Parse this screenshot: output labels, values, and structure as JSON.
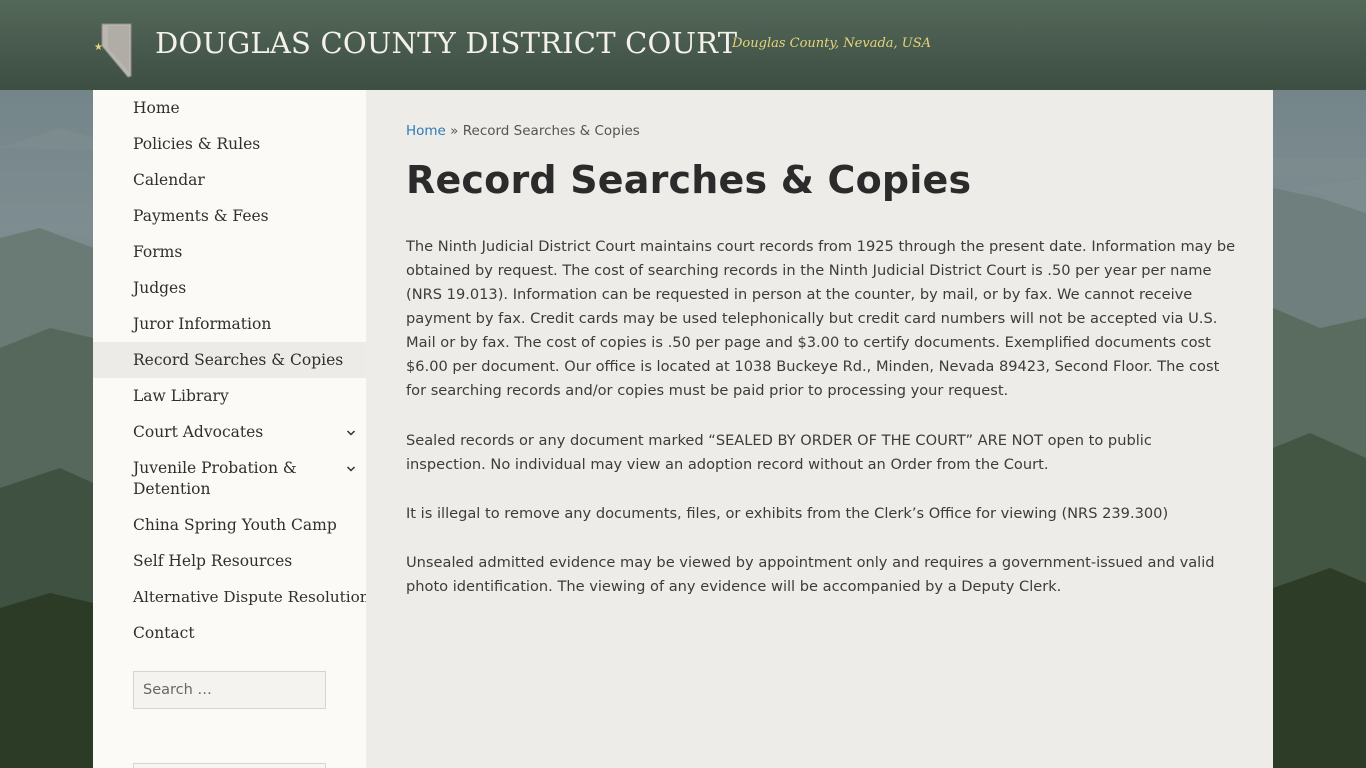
{
  "header": {
    "site_title": "DOUGLAS COUNTY DISTRICT COURT",
    "tagline": "Douglas County, Nevada, USA",
    "logo_icon": "nevada-state-icon"
  },
  "sidebar": {
    "items": [
      {
        "label": "Home"
      },
      {
        "label": "Policies & Rules"
      },
      {
        "label": "Calendar"
      },
      {
        "label": "Payments & Fees"
      },
      {
        "label": "Forms"
      },
      {
        "label": "Judges"
      },
      {
        "label": "Juror Information"
      },
      {
        "label": "Record Searches & Copies",
        "active": true
      },
      {
        "label": "Law Library"
      },
      {
        "label": "Court Advocates",
        "has_submenu": true
      },
      {
        "label": "Juvenile Probation & Detention",
        "has_submenu": true
      },
      {
        "label": "China Spring Youth Camp"
      },
      {
        "label": "Self Help Resources"
      },
      {
        "label": "Alternative Dispute Resolution"
      },
      {
        "label": "Contact"
      }
    ],
    "search_placeholder": "Search …"
  },
  "content": {
    "breadcrumb_home": "Home",
    "breadcrumb_separator": "»",
    "breadcrumb_current": "Record Searches & Copies",
    "title": "Record Searches & Copies",
    "paragraphs": [
      "The Ninth Judicial District Court maintains court records from 1925 through the present date. Information may be obtained by request. The cost of searching records in the Ninth Judicial District Court is .50 per year per name (NRS 19.013). Information can be requested in person at the counter, by mail, or by fax. We cannot receive payment by fax. Credit cards may be used telephonically but credit card numbers will not be accepted via U.S. Mail or by fax. The cost of copies is .50 per page and $3.00 to certify documents. Exemplified documents cost $6.00 per document. Our office is located at 1038 Buckeye Rd., Minden, Nevada 89423, Second Floor. The cost for searching records and/or copies must be paid prior to processing your request.",
      "Sealed records or any document marked “SEALED BY ORDER OF THE COURT” ARE NOT open to public inspection. No individual may view an adoption record without an Order from the Court.",
      "It is illegal to remove any documents, files, or exhibits from the Clerk’s Office for viewing (NRS 239.300)",
      "Unsealed admitted evidence may be viewed by appointment only and requires a government-issued and valid photo identification. The viewing of any evidence will be accompanied by a Deputy Clerk."
    ]
  },
  "colors": {
    "header_bg": "#46584b",
    "tagline": "#e2d57a",
    "link": "#2f7bb8",
    "content_bg": "#eeece8"
  }
}
